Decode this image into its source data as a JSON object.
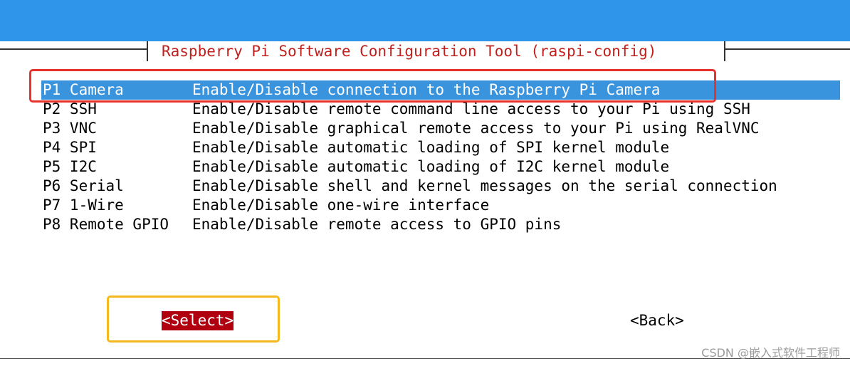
{
  "window": {
    "title": "Raspberry Pi Software Configuration Tool (raspi-config)"
  },
  "menu": {
    "selected_index": 0,
    "items": [
      {
        "key": "P1 Camera",
        "description": "Enable/Disable connection to the Raspberry Pi Camera"
      },
      {
        "key": "P2 SSH",
        "description": "Enable/Disable remote command line access to your Pi using SSH"
      },
      {
        "key": "P3 VNC",
        "description": "Enable/Disable graphical remote access to your Pi using RealVNC"
      },
      {
        "key": "P4 SPI",
        "description": "Enable/Disable automatic loading of SPI kernel module"
      },
      {
        "key": "P5 I2C",
        "description": "Enable/Disable automatic loading of I2C kernel module"
      },
      {
        "key": "P6 Serial",
        "description": "Enable/Disable shell and kernel messages on the serial connection"
      },
      {
        "key": "P7 1-Wire",
        "description": "Enable/Disable one-wire interface"
      },
      {
        "key": "P8 Remote GPIO",
        "description": "Enable/Disable remote access to GPIO pins"
      }
    ]
  },
  "buttons": {
    "select_label": "<Select>",
    "back_label": "<Back>"
  },
  "watermark": {
    "text": "CSDN @嵌入式软件工程师"
  },
  "colors": {
    "header_band": "#2f95ea",
    "title_text": "#c0201e",
    "selection_highlight": "#3a93dd",
    "select_button_bg": "#b00010",
    "annotation_red": "#e8322b",
    "annotation_yellow": "#f5b91e"
  }
}
